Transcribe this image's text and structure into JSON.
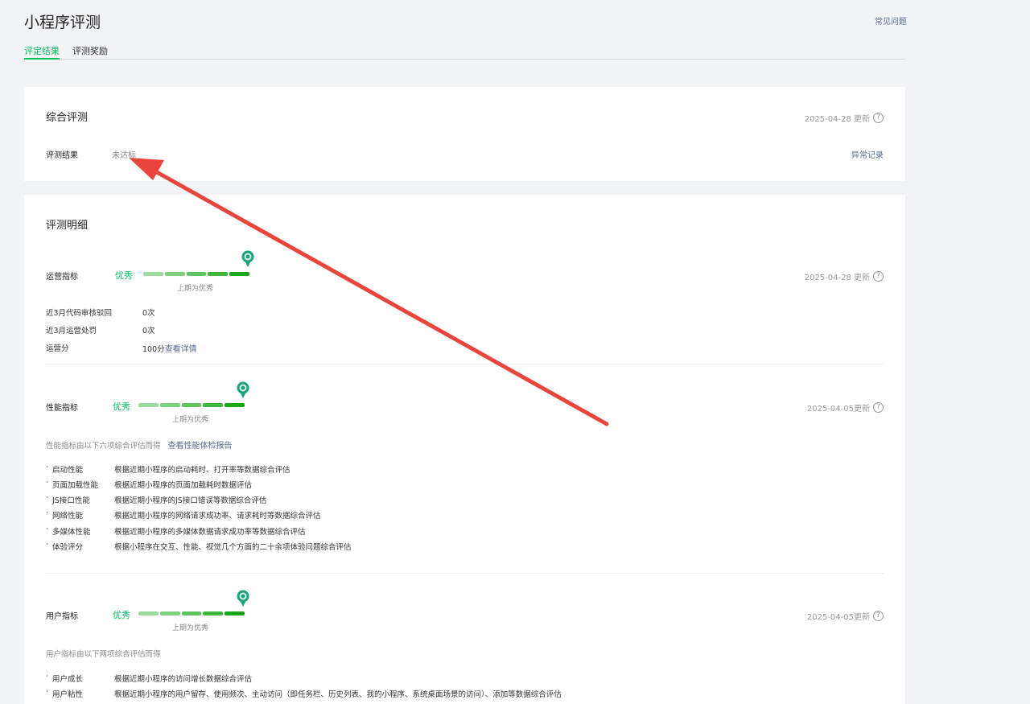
{
  "header": {
    "title": "小程序评测",
    "faq_link": "常见问题",
    "tabs": [
      {
        "label": "评定结果",
        "active": true
      },
      {
        "label": "评测奖励",
        "active": false
      }
    ]
  },
  "overall": {
    "heading": "综合评测",
    "date": "2025-04-28 更新",
    "result_label": "评测结果",
    "result_value": "未达标",
    "anomaly_link": "异常记录"
  },
  "detail": {
    "heading": "评测明细",
    "operation": {
      "label": "运营指标",
      "grade": "优秀",
      "level": 1.0,
      "prev": "上期为优秀",
      "date": "2025-04-28 更新",
      "rows": [
        {
          "key": "近3月代码审核驳回",
          "value": "0次"
        },
        {
          "key": "近3月运营处罚",
          "value": "0次"
        },
        {
          "key": "运营分",
          "value": "100分",
          "link": "查看详情"
        }
      ]
    },
    "performance": {
      "label": "性能指标",
      "grade": "优秀",
      "level": 1.0,
      "prev": "上期为优秀",
      "date": "2025-04-05更新",
      "desc": "性能指标由以下六项综合评估而得",
      "report_link": "查看性能体检报告",
      "items": [
        {
          "name": "启动性能",
          "desc": "根据近期小程序的启动耗时、打开率等数据综合评估"
        },
        {
          "name": "页面加载性能",
          "desc": "根据近期小程序的页面加载耗时数据评估"
        },
        {
          "name": "JS接口性能",
          "desc": "根据近期小程序的JS接口错误等数据综合评估"
        },
        {
          "name": "网络性能",
          "desc": "根据近期小程序的网络请求成功率、请求耗时等数据综合评估"
        },
        {
          "name": "多媒体性能",
          "desc": "根据近期小程序的多媒体数据请求成功率等数据综合评估"
        },
        {
          "name": "体验评分",
          "desc": "根据小程序在交互、性能、视觉几个方面的二十余项体验问题综合评估"
        }
      ]
    },
    "user": {
      "label": "用户指标",
      "grade": "优秀",
      "level": 1.0,
      "prev": "上期为优秀",
      "date": "2025-04-05更新",
      "desc": "用户指标由以下两项综合评估而得",
      "items": [
        {
          "name": "用户成长",
          "desc": "根据近期小程序的访问增长数据综合评估"
        },
        {
          "name": "用户粘性",
          "desc": "根据近期小程序的用户留存、使用频次、主动访问（即任务栏、历史列表、我的小程序、系统桌面场景的访问）、添加等数据综合评估"
        }
      ]
    }
  },
  "colors": {
    "accent": "#07c160",
    "link": "#576b95",
    "annotation_arrow": "#e8453c"
  },
  "icons": {
    "help": "question-circle-icon",
    "pin": "grade-badge-icon",
    "bullet": "·"
  }
}
